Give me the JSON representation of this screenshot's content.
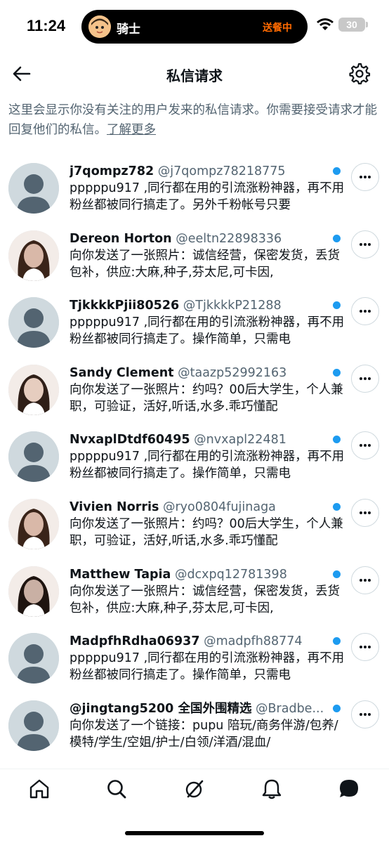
{
  "status_bar": {
    "time": "11:24",
    "island_title": "骑士",
    "island_status": "送餐中",
    "battery": "30"
  },
  "header": {
    "title": "私信请求",
    "back_icon": "arrow-left-icon",
    "settings_icon": "gear-icon"
  },
  "description": {
    "text": "这里会显示你没有关注的用户发来的私信请求。你需要接受请求才能回复他们的私信。",
    "link": "了解更多"
  },
  "colors": {
    "accent": "#1d9bf0",
    "secondary_text": "#536471",
    "primary_text": "#0f1419"
  },
  "requests": [
    {
      "name": "j7qompz782",
      "handle": "@j7qompz78218775",
      "message": "pppppu917 ,同行都在用的引流涨粉神器，再不用粉丝都被同行搞走了。另外千粉帐号只要",
      "avatar": "default"
    },
    {
      "name": "Dereon Horton",
      "handle": "@eeltn22898336",
      "message": "向你发送了一张照片：诚信经营，保密发货，丢货包补，供应:大麻,种子,芬太尼,可卡因,",
      "avatar": "photo"
    },
    {
      "name": "TjkkkkPjii80526",
      "handle": "@TjkkkkP21288",
      "message": "pppppu917 ,同行都在用的引流涨粉神器，再不用粉丝都被同行搞走了。操作简单，只需电",
      "avatar": "default"
    },
    {
      "name": "Sandy Clement",
      "handle": "@taazp52992163",
      "message": "向你发送了一张照片：约吗？00后大学生，个人兼职，可验证，活好,听话,水多.乖巧懂配",
      "avatar": "photo"
    },
    {
      "name": "NvxaplDtdf60495",
      "handle": "@nvxapl22481",
      "message": "pppppu917 ,同行都在用的引流涨粉神器，再不用粉丝都被同行搞走了。操作简单，只需电",
      "avatar": "default"
    },
    {
      "name": "Vivien Norris",
      "handle": "@ryo0804fujinaga",
      "message": "向你发送了一张照片：约吗？00后大学生，个人兼职，可验证，活好,听话,水多.乖巧懂配",
      "avatar": "photo"
    },
    {
      "name": "Matthew Tapia",
      "handle": "@dcxpq12781398",
      "message": "向你发送了一张照片：诚信经营，保密发货，丢货包补，供应:大麻,种子,芬太尼,可卡因,",
      "avatar": "photo"
    },
    {
      "name": "MadpfhRdha06937",
      "handle": "@madpfh88774",
      "message": "pppppu917 ,同行都在用的引流涨粉神器，再不用粉丝都被同行搞走了。操作简单，只需电",
      "avatar": "default"
    },
    {
      "name": "@jingtang5200 全国外围精选",
      "handle": "@Bradbe...",
      "message": "向你发送了一个链接：pupu 陪玩/商务伴游/包养/模特/学生/空姐/护士/白领/洋酒/混血/",
      "avatar": "default"
    }
  ],
  "tab_bar": {
    "tabs": [
      "home-icon",
      "search-icon",
      "grok-icon",
      "notifications-bell-icon",
      "messages-icon"
    ]
  }
}
